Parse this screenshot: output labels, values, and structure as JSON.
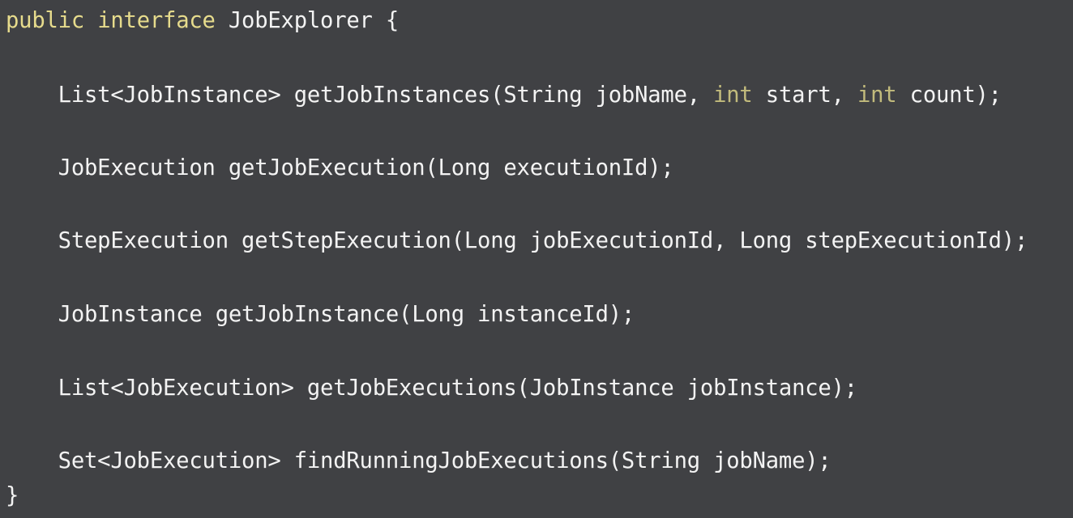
{
  "code": {
    "line1": {
      "kw_public": "public",
      "sp1": " ",
      "kw_interface": "interface",
      "rest": " JobExplorer {"
    },
    "line2": {
      "part1": "    List<JobInstance> getJobInstances(String jobName, ",
      "kw_int1": "int",
      "part2": " start, ",
      "kw_int2": "int",
      "part3": " count);"
    },
    "line3": "    JobExecution getJobExecution(Long executionId);",
    "line4": "    StepExecution getStepExecution(Long jobExecutionId, Long stepExecutionId);",
    "line5": "    JobInstance getJobInstance(Long instanceId);",
    "line6": "    List<JobExecution> getJobExecutions(JobInstance jobInstance);",
    "line7": "    Set<JobExecution> findRunningJobExecutions(String jobName);",
    "line8": "}"
  },
  "colors": {
    "background": "#404144",
    "text": "#f3f3f3",
    "keyword": "#e6db8c",
    "primitive": "#c2bb7c"
  }
}
